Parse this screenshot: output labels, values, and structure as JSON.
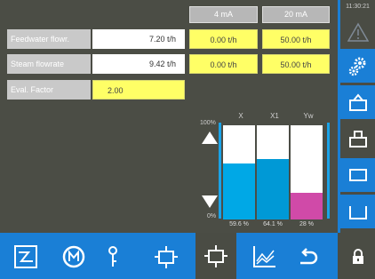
{
  "header": {
    "col_4ma": "4 mA",
    "col_20ma": "20 mA"
  },
  "rows": [
    {
      "label": "Feedwater flowr.",
      "value": "7.20 t/h",
      "min": "0.00 t/h",
      "max": "50.00 t/h"
    },
    {
      "label": "Steam flowrate",
      "value": "9.42 t/h",
      "min": "0.00 t/h",
      "max": "50.00 t/h"
    }
  ],
  "eval": {
    "label": "Eval. Factor",
    "value": "2.00"
  },
  "bars": {
    "axis_top": "100%",
    "axis_bottom": "0%",
    "items": [
      {
        "name": "X",
        "percent_label": "59.6 %",
        "fill": 59.6,
        "color": "#00a8e6"
      },
      {
        "name": "X1",
        "percent_label": "64.1 %",
        "fill": 64.1,
        "color": "#0099d6"
      },
      {
        "name": "Yw",
        "percent_label": "28 %",
        "fill": 28,
        "color": "#d04aa8"
      }
    ]
  },
  "right_sidebar": {
    "time": "11:30:21"
  },
  "colors": {
    "accent": "#1a7fd6",
    "background": "#4b4d45",
    "highlight": "#ffff66"
  }
}
